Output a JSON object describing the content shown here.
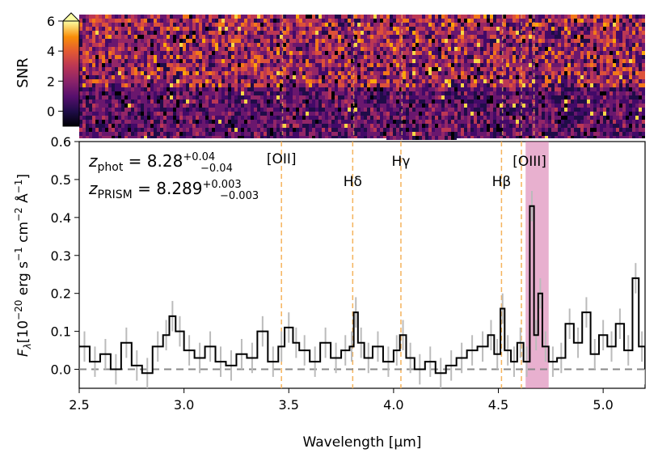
{
  "chart_data": [
    {
      "type": "heatmap",
      "name": "2D spectrum signal-to-noise map",
      "colorbar": {
        "label": "SNR",
        "colormap": "inferno",
        "range": [
          -1,
          6
        ],
        "ticks": [
          0,
          2,
          4,
          6
        ],
        "extend": "max"
      },
      "xlim": [
        2.5,
        5.2
      ],
      "line_markers": [
        3.47,
        3.81,
        4.04,
        4.52,
        4.61,
        4.67
      ]
    },
    {
      "type": "line",
      "xlabel": "Wavelength [μm]",
      "ylabel_parts": {
        "prefix": "F",
        "sub": "λ",
        "unit_text": "[10",
        "sup1": "−20",
        "mid": " erg s",
        "sup2": "−1",
        "mid2": " cm",
        "sup3": "−2",
        "mid3": " Å",
        "sup4": "−1",
        "end": "]"
      },
      "xlim": [
        2.5,
        5.2
      ],
      "ylim": [
        -0.05,
        0.6
      ],
      "xticks": [
        "2.5",
        "3.0",
        "3.5",
        "4.0",
        "4.5",
        "5.0"
      ],
      "yticks": [
        "0.0",
        "0.1",
        "0.2",
        "0.3",
        "0.4",
        "0.5",
        "0.6"
      ],
      "zero_line": 0.0,
      "grid": false,
      "annotations": {
        "zphot": {
          "base": "z",
          "sub": "phot",
          "eq": " = 8.28",
          "sup": "+0.04",
          "lo": "−0.04"
        },
        "zprism": {
          "base": "z",
          "sub": "PRISM",
          "eq": " = 8.289",
          "sup": "+0.003",
          "lo": "−0.003"
        }
      },
      "emission_lines": [
        {
          "label": "[OII]",
          "x": 3.465
        },
        {
          "label": "Hδ",
          "x": 3.805
        },
        {
          "label": "Hγ",
          "x": 4.035
        },
        {
          "label": "Hβ",
          "x": 4.515
        },
        {
          "label": "[OIII]",
          "x": 4.61
        }
      ],
      "highlight_band": {
        "x": [
          4.63,
          4.74
        ],
        "color": "#d66fa8"
      },
      "series": [
        {
          "style": "step",
          "color": "#000000",
          "points": [
            [
              2.5,
              0.06
            ],
            [
              2.55,
              0.02
            ],
            [
              2.6,
              0.04
            ],
            [
              2.65,
              0.0
            ],
            [
              2.7,
              0.07
            ],
            [
              2.75,
              0.01
            ],
            [
              2.8,
              -0.01
            ],
            [
              2.85,
              0.06
            ],
            [
              2.9,
              0.09
            ],
            [
              2.93,
              0.14
            ],
            [
              2.96,
              0.1
            ],
            [
              3.0,
              0.05
            ],
            [
              3.05,
              0.03
            ],
            [
              3.1,
              0.06
            ],
            [
              3.15,
              0.02
            ],
            [
              3.2,
              0.01
            ],
            [
              3.25,
              0.04
            ],
            [
              3.3,
              0.03
            ],
            [
              3.35,
              0.1
            ],
            [
              3.4,
              0.02
            ],
            [
              3.45,
              0.06
            ],
            [
              3.48,
              0.11
            ],
            [
              3.52,
              0.07
            ],
            [
              3.55,
              0.05
            ],
            [
              3.6,
              0.02
            ],
            [
              3.65,
              0.07
            ],
            [
              3.7,
              0.03
            ],
            [
              3.75,
              0.05
            ],
            [
              3.79,
              0.06
            ],
            [
              3.81,
              0.15
            ],
            [
              3.83,
              0.07
            ],
            [
              3.86,
              0.03
            ],
            [
              3.9,
              0.06
            ],
            [
              3.95,
              0.02
            ],
            [
              4.0,
              0.05
            ],
            [
              4.03,
              0.09
            ],
            [
              4.06,
              0.03
            ],
            [
              4.1,
              0.0
            ],
            [
              4.15,
              0.02
            ],
            [
              4.2,
              -0.01
            ],
            [
              4.25,
              0.01
            ],
            [
              4.3,
              0.03
            ],
            [
              4.35,
              0.05
            ],
            [
              4.4,
              0.06
            ],
            [
              4.45,
              0.09
            ],
            [
              4.48,
              0.04
            ],
            [
              4.51,
              0.16
            ],
            [
              4.53,
              0.05
            ],
            [
              4.56,
              0.02
            ],
            [
              4.59,
              0.07
            ],
            [
              4.62,
              0.02
            ],
            [
              4.65,
              0.43
            ],
            [
              4.67,
              0.09
            ],
            [
              4.69,
              0.2
            ],
            [
              4.71,
              0.06
            ],
            [
              4.74,
              0.02
            ],
            [
              4.78,
              0.03
            ],
            [
              4.82,
              0.12
            ],
            [
              4.86,
              0.07
            ],
            [
              4.9,
              0.15
            ],
            [
              4.94,
              0.04
            ],
            [
              4.98,
              0.09
            ],
            [
              5.02,
              0.06
            ],
            [
              5.06,
              0.12
            ],
            [
              5.1,
              0.05
            ],
            [
              5.14,
              0.24
            ],
            [
              5.17,
              0.06
            ],
            [
              5.2,
              0.0
            ]
          ]
        }
      ]
    }
  ]
}
